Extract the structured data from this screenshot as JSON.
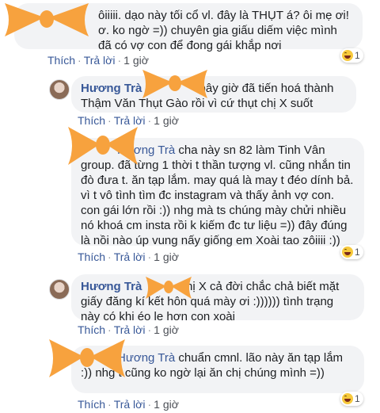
{
  "colors": {
    "link": "#385898",
    "bubble": "#f2f3f5",
    "bow": "#f7a23e"
  },
  "actions": {
    "like": "Thích",
    "reply": "Trả lời",
    "sep": "·"
  },
  "comments": [
    {
      "author": "",
      "text": "ôiiiii. dạo này tối cổ vl. đây là THỤT á? ôi mẹ ơi! ơ. ko ngờ =)) chuyên gia giấu diếm việc mình đã có vợ con để đong gái khắp nơi",
      "time": "1 giờ",
      "reaction_count": "1",
      "reaction_icon": "haha-icon"
    },
    {
      "author": "Hương Trà",
      "text": "bây giờ đã tiến hoá thành Thậm Văn Thụt Gào rồi vì cứ thụt chị X suốt",
      "time": "1 giờ"
    },
    {
      "author": "Hương Trà",
      "text": "cha này sn 82 làm Tinh Vân group. đã từng 1 thời t thần tượng vl. cũng nhắn tin đò đưa t. ăn tạp lắm. may quá là may t đéo dính bả. vì t vô tình tìm đc instagram và thấy ảnh vợ con. con gái lớn rồi :)) nhg mà ts chúng mày chửi nhiều nó khoá cm insta rồi k kiếm đc tư liệu =)) đây đúng là nồi nào úp vung nấy giống em Xoài tao zôiiii :))",
      "time": "1 giờ",
      "reaction_count": "1",
      "reaction_icon": "haha-icon"
    },
    {
      "author": "Hương Trà",
      "text": "chị X cả đời chắc chả biết mặt giấy đăng kí kết hôn quá mày ơi :)))))) tình trạng này có khi éo le hơn con xoài",
      "time": "1 giờ"
    },
    {
      "author": "Hương Trà",
      "text": "chuẩn cmnl. lão này ăn tạp lắm :)) nhg t cũng ko ngờ lại ăn chị chúng mình =))",
      "time": "1 giờ",
      "reaction_count": "1",
      "reaction_icon": "haha-icon"
    }
  ]
}
